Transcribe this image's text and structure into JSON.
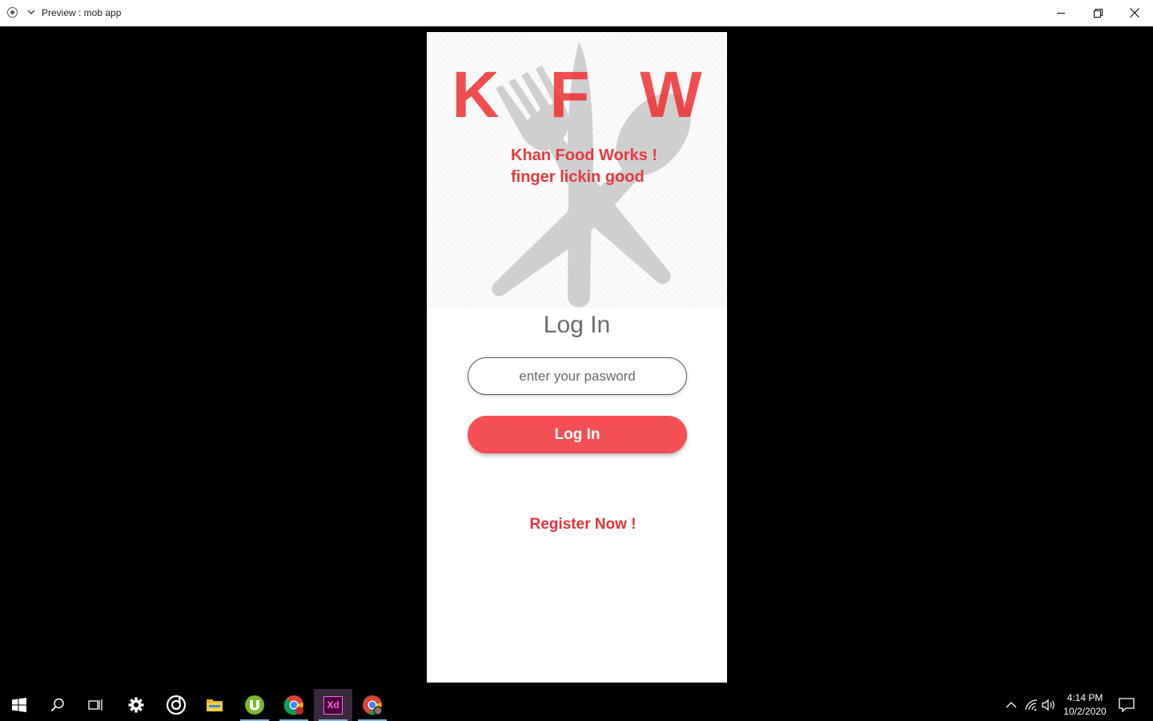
{
  "window": {
    "title": "Preview : mob app"
  },
  "app": {
    "logo": "K F W",
    "tagline_line1": "Khan Food Works !",
    "tagline_line2": "finger lickin good",
    "heading": "Log In",
    "password_placeholder": "enter your pasword",
    "password_value": "",
    "login_button": "Log In",
    "register_link": "Register Now !"
  },
  "colors": {
    "accent": "#f44f54",
    "logo": "#e53a40",
    "heading": "#6b6b6b",
    "cutlery": "#cfcfcf"
  },
  "taskbar": {
    "items": [
      "windows-start-icon",
      "search-icon",
      "task-view-icon",
      "settings-icon",
      "groove-music-icon",
      "file-explorer-icon",
      "utorrent-icon",
      "chrome-icon",
      "adobe-xd-icon",
      "chrome-profile-icon"
    ],
    "xd_label": "Xd",
    "time": "4:14 PM",
    "date": "10/2/2020"
  }
}
